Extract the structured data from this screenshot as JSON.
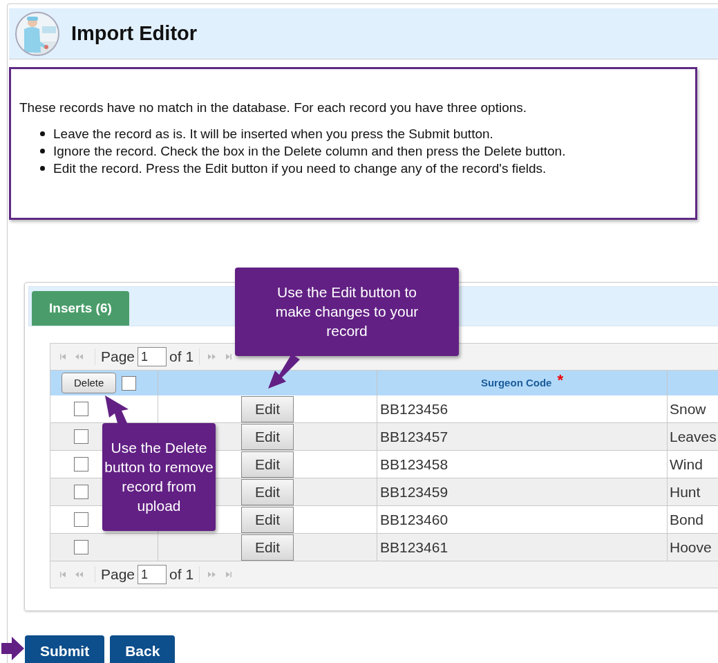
{
  "header": {
    "title": "Import Editor"
  },
  "instructions": {
    "intro": "These records have no match in the database. For each record you have three options.",
    "options": [
      "Leave the record as is. It will be inserted when you press the Submit button.",
      "Ignore the record. Check the box in the Delete column and then press the Delete button.",
      "Edit the record. Press the Edit button if you need to change any of the record's fields."
    ]
  },
  "tabs": [
    {
      "label": "Inserts (6)",
      "selected": true
    }
  ],
  "pager_top": {
    "page_label": "Page",
    "page_value": "1",
    "of_label": "of 1"
  },
  "table": {
    "delete_button": "Delete",
    "select_all_checked": false,
    "columns": [
      "Surgeon Code"
    ],
    "required_mark": "*",
    "rows": [
      {
        "checked": false,
        "edit": "Edit",
        "surgeon_code": "BB123456",
        "column_4": "Snow"
      },
      {
        "checked": false,
        "edit": "Edit",
        "surgeon_code": "BB123457",
        "column_4": "Leaves"
      },
      {
        "checked": false,
        "edit": "Edit",
        "surgeon_code": "BB123458",
        "column_4": "Wind"
      },
      {
        "checked": false,
        "edit": "Edit",
        "surgeon_code": "BB123459",
        "column_4": "Hunt"
      },
      {
        "checked": false,
        "edit": "Edit",
        "surgeon_code": "BB123460",
        "column_4": "Bond"
      },
      {
        "checked": false,
        "edit": "Edit",
        "surgeon_code": "BB123461",
        "column_4": "Hoove"
      }
    ]
  },
  "pager_bottom": {
    "page_label": "Page",
    "page_value": "1",
    "of_label": "of 1"
  },
  "callouts": [
    {
      "text": "Use the Edit button to make changes to your record"
    },
    {
      "text": "Use the Delete button to remove record from upload"
    }
  ],
  "buttons": [
    "Submit",
    "Back"
  ]
}
